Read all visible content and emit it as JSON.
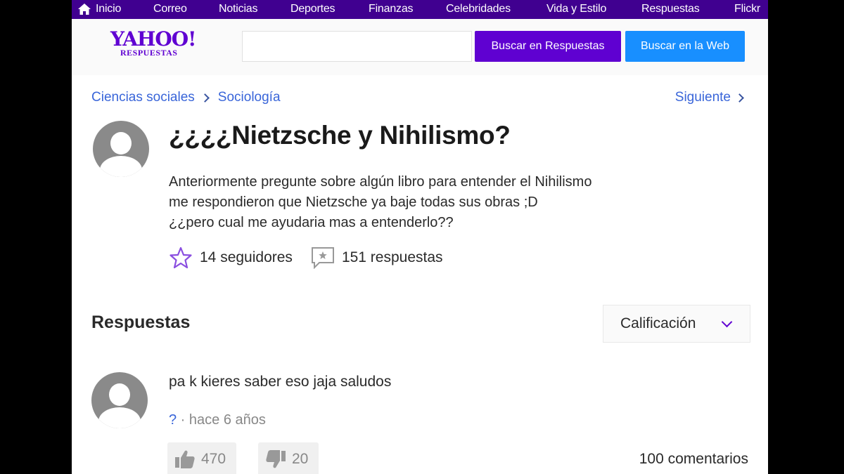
{
  "topnav": {
    "items": [
      "Inicio",
      "Correo",
      "Noticias",
      "Deportes",
      "Finanzas",
      "Celebridades",
      "Vida y Estilo",
      "Respuestas",
      "Flickr"
    ]
  },
  "header": {
    "logo_main": "YAHOO!",
    "logo_sub": "RESPUESTAS",
    "search_value": "",
    "search_answers_label": "Buscar en Respuestas",
    "search_web_label": "Buscar en la Web"
  },
  "breadcrumb": {
    "items": [
      "Ciencias sociales",
      "Sociología"
    ],
    "next_label": "Siguiente"
  },
  "question": {
    "title": "¿¿¿¿Nietzsche y Nihilismo?",
    "body_lines": [
      "Anteriormente pregunte sobre algún libro para entender el Nihilismo",
      "me respondieron que Nietzsche ya baje todas sus obras ;D",
      "¿¿pero cual me ayudaria mas a entenderlo??"
    ],
    "followers": "14 seguidores",
    "answers_count": "151 respuestas"
  },
  "answers_section": {
    "title": "Respuestas",
    "sort_label": "Calificación"
  },
  "answer": {
    "text": "pa k kieres saber eso jaja saludos",
    "author": "?",
    "separator": " · ",
    "time": "hace 6 años",
    "upvotes": "470",
    "downvotes": "20",
    "comments": "100 comentarios"
  },
  "colors": {
    "nav_bg": "#400090",
    "brand_purple": "#5f01d1",
    "web_blue": "#188fff",
    "link_blue": "#3965d9"
  }
}
